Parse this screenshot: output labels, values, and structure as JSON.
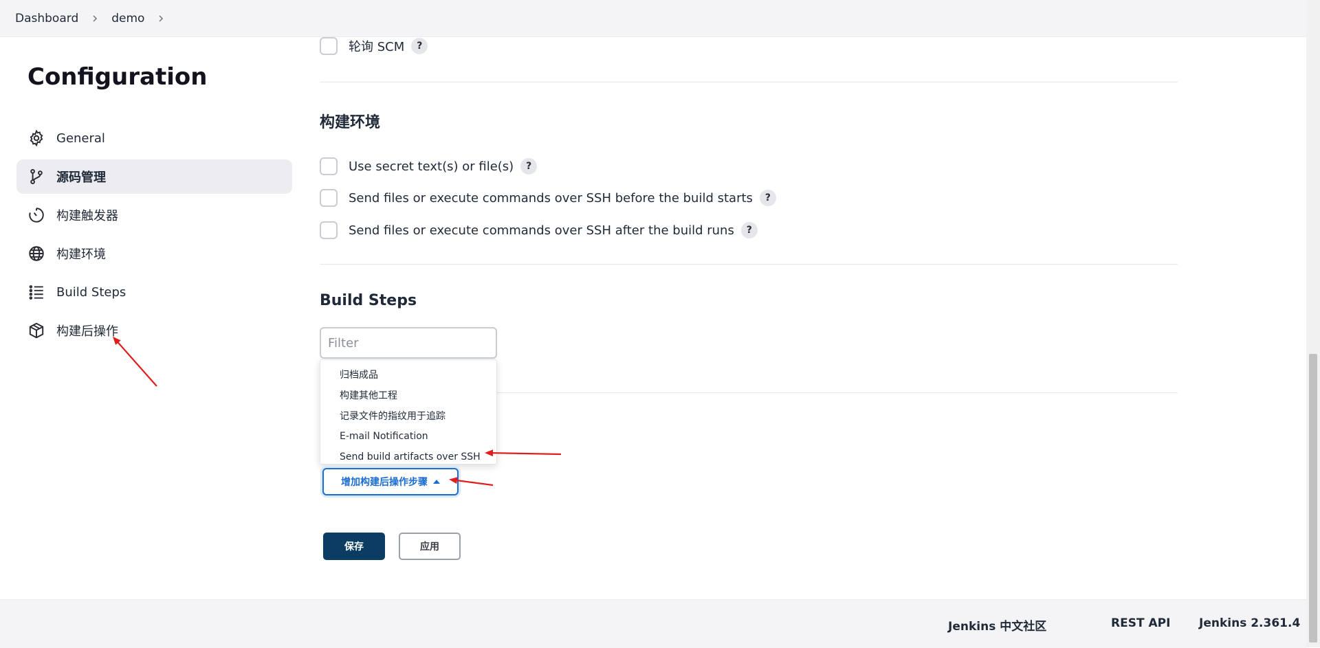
{
  "breadcrumb": {
    "items": [
      "Dashboard",
      "demo"
    ]
  },
  "page": {
    "title": "Configuration"
  },
  "sidebar": {
    "items": [
      {
        "label": "General",
        "icon": "gear-icon",
        "active": false
      },
      {
        "label": "源码管理",
        "icon": "branch-icon",
        "active": true
      },
      {
        "label": "构建触发器",
        "icon": "clock-icon",
        "active": false
      },
      {
        "label": "构建环境",
        "icon": "globe-icon",
        "active": false
      },
      {
        "label": "Build Steps",
        "icon": "list-icon",
        "active": false
      },
      {
        "label": "构建后操作",
        "icon": "package-icon",
        "active": false
      }
    ]
  },
  "main": {
    "poll_scm": {
      "label": "轮询 SCM",
      "help": "?"
    },
    "build_env": {
      "title": "构建环境",
      "options": [
        {
          "label": "Use secret text(s) or file(s)",
          "help": "?"
        },
        {
          "label": "Send files or execute commands over SSH before the build starts",
          "help": "?"
        },
        {
          "label": "Send files or execute commands over SSH after the build runs",
          "help": "?"
        }
      ]
    },
    "build_steps": {
      "title": "Build Steps",
      "filter_placeholder": "Filter",
      "dropdown_items": [
        "归档成品",
        "构建其他工程",
        "记录文件的指纹用于追踪",
        "E-mail Notification",
        "Send build artifacts over SSH"
      ]
    },
    "post_build_button": {
      "label": "增加构建后操作步骤"
    },
    "actions": {
      "save": "保存",
      "apply": "应用"
    }
  },
  "footer": {
    "links": [
      "Jenkins 中文社区",
      "REST API",
      "Jenkins 2.361.4"
    ]
  },
  "colors": {
    "accent": "#1c6dd0",
    "save_bg": "#0b3d62",
    "annotation_arrow": "#e11d1d"
  }
}
